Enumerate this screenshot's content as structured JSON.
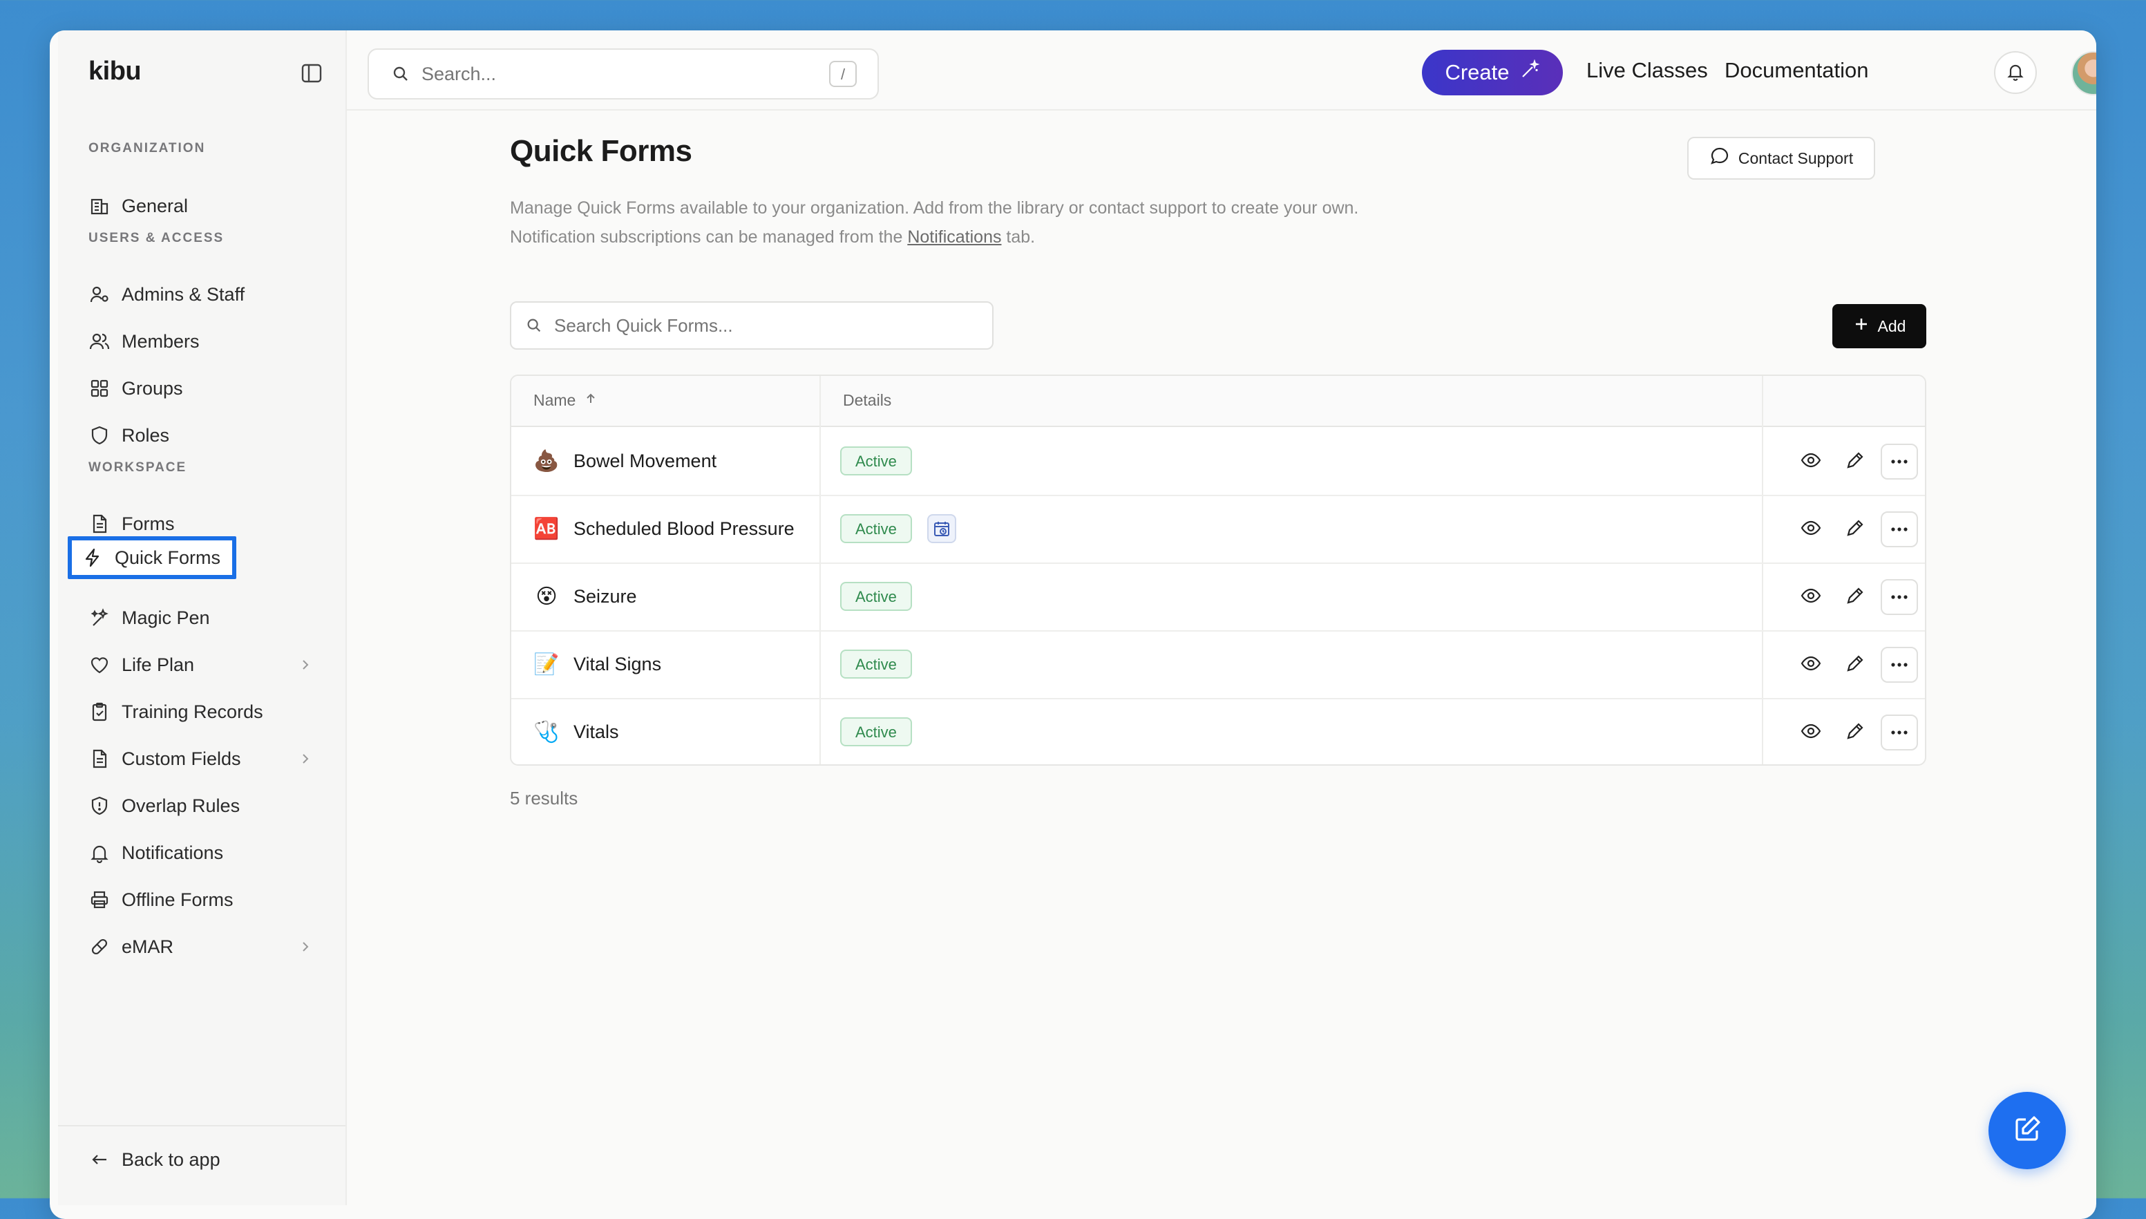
{
  "brand": "kibu",
  "topbar": {
    "search_placeholder": "Search...",
    "search_shortcut": "/",
    "create_label": "Create",
    "live_classes_label": "Live Classes",
    "documentation_label": "Documentation"
  },
  "sidebar": {
    "sections": {
      "organization": "ORGANIZATION",
      "users_access": "USERS & ACCESS",
      "workspace": "WORKSPACE"
    },
    "items": [
      {
        "label": "General",
        "icon": "building-icon"
      },
      {
        "label": "Admins & Staff",
        "icon": "user-gear-icon"
      },
      {
        "label": "Members",
        "icon": "users-icon"
      },
      {
        "label": "Groups",
        "icon": "grid-icon"
      },
      {
        "label": "Roles",
        "icon": "shield-icon"
      },
      {
        "label": "Forms",
        "icon": "document-icon"
      },
      {
        "label": "Quick Forms",
        "icon": "lightning-icon",
        "active": true
      },
      {
        "label": "Magic Pen",
        "icon": "sparkles-icon"
      },
      {
        "label": "Life Plan",
        "icon": "heart-icon",
        "expandable": true
      },
      {
        "label": "Training Records",
        "icon": "clipboard-check-icon"
      },
      {
        "label": "Custom Fields",
        "icon": "document-icon",
        "expandable": true
      },
      {
        "label": "Overlap Rules",
        "icon": "shield-alert-icon"
      },
      {
        "label": "Notifications",
        "icon": "bell-icon"
      },
      {
        "label": "Offline Forms",
        "icon": "printer-icon"
      },
      {
        "label": "eMAR",
        "icon": "pill-icon",
        "expandable": true
      }
    ],
    "back_label": "Back to app"
  },
  "main": {
    "title": "Quick Forms",
    "contact_support_label": "Contact Support",
    "description_line1": "Manage Quick Forms available to your organization. Add from the library or contact support to create your own.",
    "description_line2_prefix": "Notification subscriptions can be managed from the ",
    "description_link": "Notifications",
    "description_line2_suffix": " tab.",
    "search_placeholder": "Search Quick Forms...",
    "add_label": "Add",
    "table": {
      "columns": [
        "Name",
        "Details"
      ],
      "rows": [
        {
          "emoji": "💩",
          "name": "Bowel Movement",
          "status": "Active",
          "scheduled": false
        },
        {
          "emoji": "🆎",
          "name": "Scheduled Blood Pressure",
          "status": "Active",
          "scheduled": true
        },
        {
          "emoji": "😵",
          "name": "Seizure",
          "status": "Active",
          "scheduled": false
        },
        {
          "emoji": "📝",
          "name": "Vital Signs",
          "status": "Active",
          "scheduled": false
        },
        {
          "emoji": "🩺",
          "name": "Vitals",
          "status": "Active",
          "scheduled": false
        }
      ]
    },
    "results_text": "5 results"
  },
  "colors": {
    "accent": "#1a6fe6",
    "create_gradient_start": "#3b36c9",
    "create_gradient_end": "#5a2fb9",
    "badge_green": "#2f8a4d"
  }
}
